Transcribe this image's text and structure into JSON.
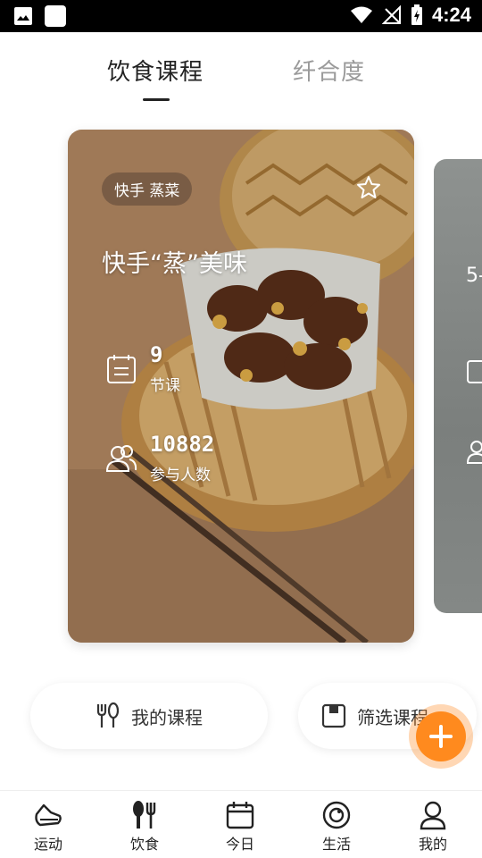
{
  "status_bar": {
    "time": "4:24"
  },
  "tabs": [
    {
      "label": "饮食课程",
      "active": true
    },
    {
      "label": "纤合度",
      "active": false
    }
  ],
  "course_card": {
    "tag": "快手 蒸菜",
    "title": "快手“蒸”美味",
    "lessons": {
      "value": "9",
      "label": "节课"
    },
    "participants": {
      "value": "10882",
      "label": "参与人数"
    }
  },
  "next_card": {
    "partial_value": "5-"
  },
  "actions": {
    "my_courses": "我的课程",
    "filter_courses": "筛选课程"
  },
  "bottom_nav": [
    {
      "label": "运动",
      "icon": "sneaker-icon"
    },
    {
      "label": "饮食",
      "icon": "food-icon"
    },
    {
      "label": "今日",
      "icon": "calendar-icon"
    },
    {
      "label": "生活",
      "icon": "life-icon"
    },
    {
      "label": "我的",
      "icon": "person-icon"
    }
  ],
  "colors": {
    "accent": "#ff8a1e",
    "text": "#222222",
    "inactive": "#9a9a9a"
  }
}
